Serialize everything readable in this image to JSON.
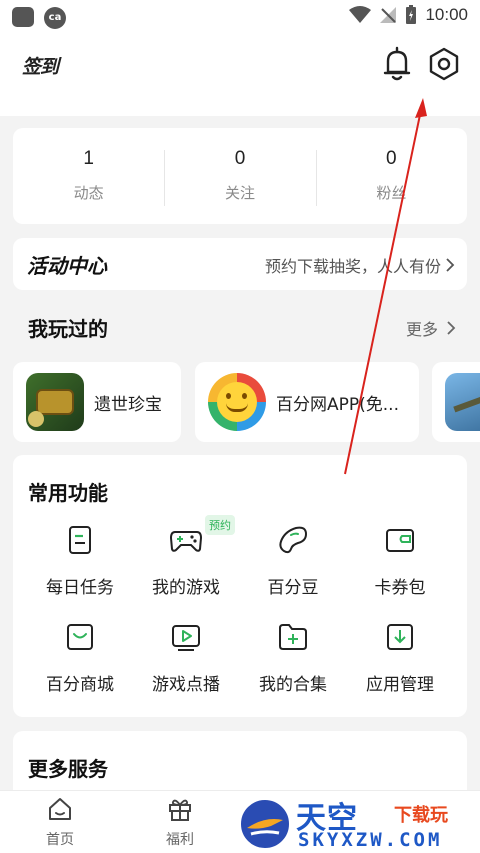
{
  "status_bar": {
    "time": "10:00"
  },
  "header": {
    "signin_label": "签到",
    "icons": [
      "bell-icon",
      "gear-icon"
    ]
  },
  "stats": [
    {
      "value": "1",
      "label": "动态"
    },
    {
      "value": "0",
      "label": "关注"
    },
    {
      "value": "0",
      "label": "粉丝"
    }
  ],
  "activity": {
    "title": "活动中心",
    "description": "预约下载抽奖，人人有份"
  },
  "played": {
    "title": "我玩过的",
    "more": "更多",
    "games": [
      {
        "name": "遗世珍宝"
      },
      {
        "name": "百分网APP(免..."
      },
      {
        "name": ""
      }
    ]
  },
  "functions": {
    "title": "常用功能",
    "badge": "预约",
    "items": [
      {
        "label": "每日任务",
        "icon": "task-icon"
      },
      {
        "label": "我的游戏",
        "icon": "gamepad-icon"
      },
      {
        "label": "百分豆",
        "icon": "bean-icon"
      },
      {
        "label": "卡券包",
        "icon": "wallet-icon"
      },
      {
        "label": "百分商城",
        "icon": "shop-icon"
      },
      {
        "label": "游戏点播",
        "icon": "play-icon"
      },
      {
        "label": "我的合集",
        "icon": "folder-add-icon"
      },
      {
        "label": "应用管理",
        "icon": "download-box-icon"
      }
    ]
  },
  "more_services": {
    "title": "更多服务"
  },
  "tabs": [
    {
      "label": "首页",
      "icon": "home-icon"
    },
    {
      "label": "福利",
      "icon": "gift-icon"
    }
  ],
  "watermark": {
    "title": "天空",
    "sub": "下载玩",
    "url": "SKYXZW.COM"
  },
  "colors": {
    "accent": "#2fb35a",
    "arrow": "#d9231d",
    "watermark_blue": "#1e58c6"
  }
}
